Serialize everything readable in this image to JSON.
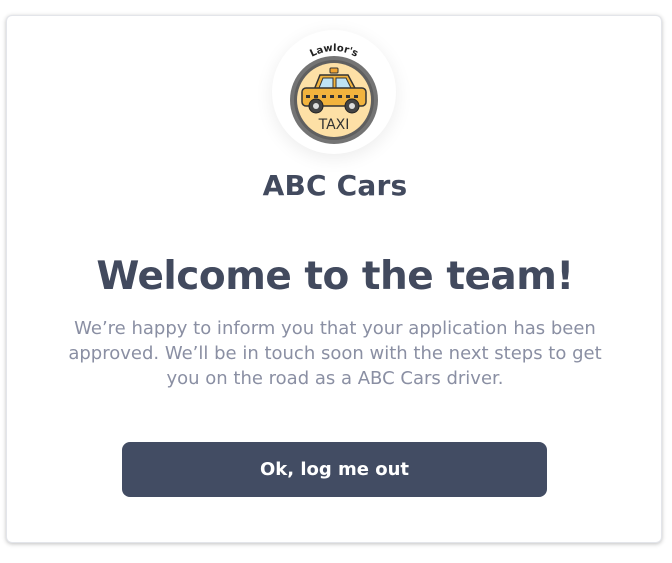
{
  "logo": {
    "arc_text": "Lawlor's",
    "badge_text": "TAXI",
    "icon": "taxi-icon",
    "colors": {
      "badge_fill": "#fde0a6",
      "ring": "#747474",
      "car_body": "#f2b33d",
      "window": "#bfe3f5"
    }
  },
  "brand": {
    "name": "ABC Cars"
  },
  "main": {
    "heading": "Welcome to the team!",
    "message": "We’re happy to inform you that your application has been approved. We’ll be in touch soon with the next steps to get you on the road as a ABC Cars driver.",
    "button_label": "Ok, log me out"
  },
  "colors": {
    "primary_text": "#424a5e",
    "secondary_text": "#8a8fa3",
    "button_bg": "#424c63",
    "button_text": "#ffffff"
  }
}
